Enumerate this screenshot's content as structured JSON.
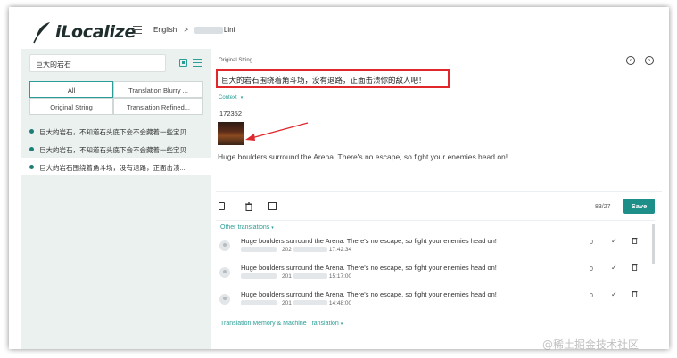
{
  "header": {
    "logo_text": "iLocalize",
    "breadcrumb_language": "English",
    "breadcrumb_sep": ">",
    "breadcrumb_file": "Lini"
  },
  "sidebar": {
    "search_value": "巨大的岩石",
    "tabs": [
      "All",
      "Translation Blurry ...",
      "Original String",
      "Translation Refined..."
    ],
    "items": [
      "巨大的岩石，不知道石头底下会不会藏着一些宝贝",
      "巨大的岩石，不知道石头底下会不会藏着一些宝贝",
      "巨大的岩石围绕着角斗场，没有退路，正面击溃..."
    ]
  },
  "editor": {
    "original_label": "Original String",
    "source_text": "巨大的岩石围绕着角斗场，没有退路，正面击溃你的敌人吧！",
    "context_label": "Context",
    "context_id": "172352",
    "translation": "Huge boulders surround the Arena. There's no escape, so fight your enemies head on!",
    "counter": "83/27",
    "save_label": "Save"
  },
  "others": {
    "label": "Other translations",
    "rows": [
      {
        "text": "Huge boulders surround the Arena. There's no escape, so fight your enemies head on!",
        "date": "202",
        "time": "17:42:34",
        "count": "0"
      },
      {
        "text": "Huge boulders surround the Arena. There's no escape, so fight your enemies head on!",
        "date": "201",
        "time": "15:17:00",
        "count": "0"
      },
      {
        "text": "Huge boulders surround the Arena. There's no escape, so fight your enemies head on!",
        "date": "201",
        "time": "14:48:00",
        "count": "0"
      }
    ]
  },
  "tm_label": "Translation Memory & Machine Translation",
  "watermark": "@稀土掘金技术社区",
  "colors": {
    "accent": "#1d8f88",
    "highlight": "#e0282c",
    "panel": "#eaf1ef"
  }
}
